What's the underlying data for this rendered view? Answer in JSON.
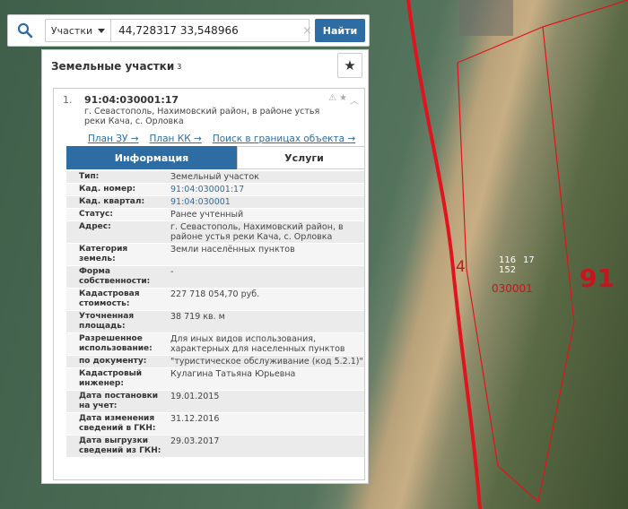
{
  "search": {
    "mode_label": "Участки",
    "query": "44,728317 33,548966",
    "clear_symbol": "×",
    "find_label": "Найти"
  },
  "panel": {
    "title": "Земельные участки",
    "count": "3"
  },
  "card": {
    "index": "1.",
    "cad_number": "91:04:030001:17",
    "address": "г. Севастополь, Нахимовский район, в районе устья реки Кача, с. Орловка",
    "links": [
      "План ЗУ →",
      "План КК →",
      "Поиск в границах объекта →"
    ],
    "tabs": [
      "Информация",
      "Услуги"
    ]
  },
  "info_rows": [
    {
      "label": "Тип:",
      "value": "Земельный участок"
    },
    {
      "label": "Кад. номер:",
      "value": "91:04:030001:17"
    },
    {
      "label": "Кад. квартал:",
      "value": "91:04:030001"
    },
    {
      "label": "Статус:",
      "value": "Ранее учтенный"
    },
    {
      "label": "Адрес:",
      "value": "г. Севастополь, Нахимовский район, в районе устья реки Кача, с. Орловка"
    },
    {
      "label": "Категория земель:",
      "value": "Земли населённых пунктов"
    },
    {
      "label": "Форма собственности:",
      "value": "-"
    },
    {
      "label": "Кадастровая стоимость:",
      "value": "227 718 054,70 руб."
    },
    {
      "label": "Уточненная площадь:",
      "value": "38 719 кв. м"
    },
    {
      "label": "Разрешенное использование:",
      "value": "Для иных видов использования, характерных для населенных пунктов"
    },
    {
      "label": "по документу:",
      "value": "\"туристическое обслуживание (код 5.2.1)\""
    },
    {
      "label": "Кадастровый инженер:",
      "value": "Кулагина Татьяна Юрьевна"
    },
    {
      "label": "Дата постановки на учет:",
      "value": "19.01.2015"
    },
    {
      "label": "Дата изменения сведений в ГКН:",
      "value": "31.12.2016"
    },
    {
      "label": "Дата выгрузки сведений из ГКН:",
      "value": "29.03.2017"
    }
  ],
  "map_labels": {
    "district": "91",
    "quarter": "030001",
    "zone": "4",
    "n1": "116",
    "n2": "17",
    "n3": "152"
  },
  "colors": {
    "accent": "#2e6da4",
    "boundary": "#e0141e"
  }
}
